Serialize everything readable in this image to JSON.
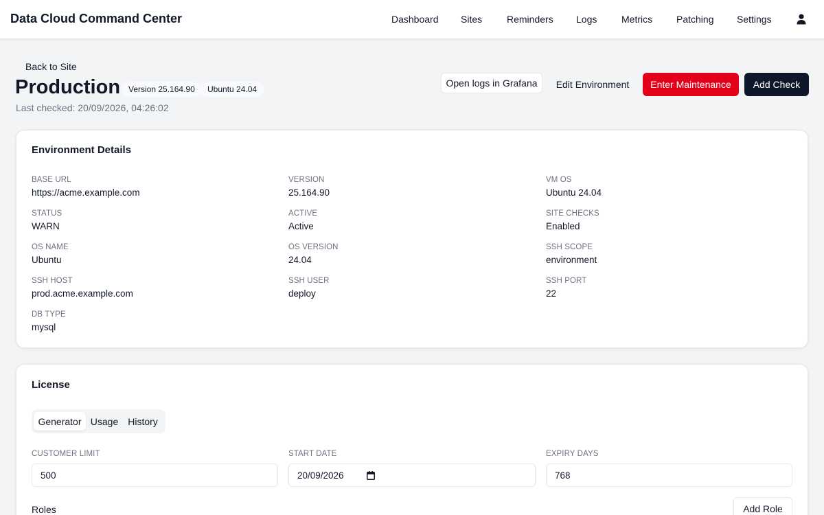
{
  "app": {
    "title": "Data Cloud Command Center",
    "nav": [
      "Dashboard",
      "Sites",
      "Reminders",
      "Logs",
      "Metrics",
      "Patching",
      "Settings"
    ],
    "user_icon": "user-icon"
  },
  "header": {
    "back_label": "Back to Site",
    "title": "Production",
    "version_chip": "Version 25.164.90",
    "os_chip": "Ubuntu 24.04",
    "last_checked": "Last checked: 20/09/2026, 04:26:02",
    "buttons": {
      "grafana": "Open logs in Grafana",
      "edit": "Edit Environment",
      "maintenance": "Enter Maintenance",
      "add_check": "Add Check"
    },
    "colors": {
      "danger": "#e2001a",
      "dark": "#0f172a"
    }
  },
  "details": {
    "title": "Environment Details",
    "fields": [
      {
        "label": "BASE URL",
        "value": "https://acme.example.com"
      },
      {
        "label": "VERSION",
        "value": "25.164.90"
      },
      {
        "label": "VM OS",
        "value": "Ubuntu 24.04"
      },
      {
        "label": "STATUS",
        "value": "WARN"
      },
      {
        "label": "ACTIVE",
        "value": "Active"
      },
      {
        "label": "SITE CHECKS",
        "value": "Enabled"
      },
      {
        "label": "OS NAME",
        "value": "Ubuntu"
      },
      {
        "label": "OS VERSION",
        "value": "24.04"
      },
      {
        "label": "SSH SCOPE",
        "value": "environment"
      },
      {
        "label": "SSH HOST",
        "value": "prod.acme.example.com"
      },
      {
        "label": "SSH USER",
        "value": "deploy"
      },
      {
        "label": "SSH PORT",
        "value": "22"
      },
      {
        "label": "DB TYPE",
        "value": "mysql"
      }
    ]
  },
  "license": {
    "title": "License",
    "tabs": [
      "Generator",
      "Usage",
      "History"
    ],
    "active_tab": "Generator",
    "fields": {
      "customer_limit": {
        "label": "CUSTOMER LIMIT",
        "value": "500"
      },
      "start_date": {
        "label": "START DATE",
        "value": "20/09/2026"
      },
      "expiry_days": {
        "label": "EXPIRY DAYS",
        "value": "768"
      }
    },
    "roles_label": "Roles",
    "add_role": "Add Role"
  }
}
